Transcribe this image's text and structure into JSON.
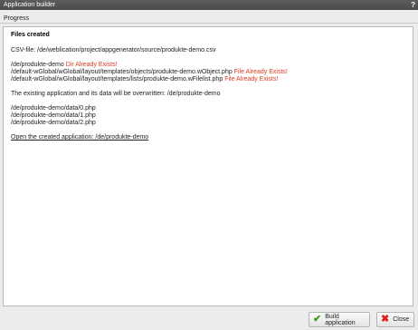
{
  "window": {
    "title": "Application builder",
    "help_label": "?"
  },
  "section": {
    "label": "Progress"
  },
  "content": {
    "heading": "Files created",
    "csv_line": "CSV-file: /de/weblication/project/appgenerator/source/produkte-demo.csv",
    "entries": [
      {
        "path": "/de/produkte-demo",
        "status": "Dir Already Exists!"
      },
      {
        "path": "/default-wGlobal/wGlobal/layout/templates/objects/produkte-demo.wObject.php",
        "status": "File Already Exists!"
      },
      {
        "path": "/default-wGlobal/wGlobal/layout/templates/lists/produkte-demo.wFilelist.php",
        "status": "File Already Exists!"
      }
    ],
    "overwrite_notice": "The existing application and its data will be overwritten: /de/produkte-demo",
    "data_files": [
      "/de/produkte-demo/data/0.php",
      "/de/produkte-demo/data/1.php",
      "/de/produkte-demo/data/2.php"
    ],
    "open_link": "Open the created application: /de/produkte-demo"
  },
  "footer": {
    "build_label": "Build application",
    "build_icon": "checkmark-icon",
    "close_label": "Close",
    "close_icon": "x-icon"
  },
  "colors": {
    "status_red": "#e03a1e",
    "check_green": "#3a9a1f",
    "close_red": "#e0221a"
  }
}
